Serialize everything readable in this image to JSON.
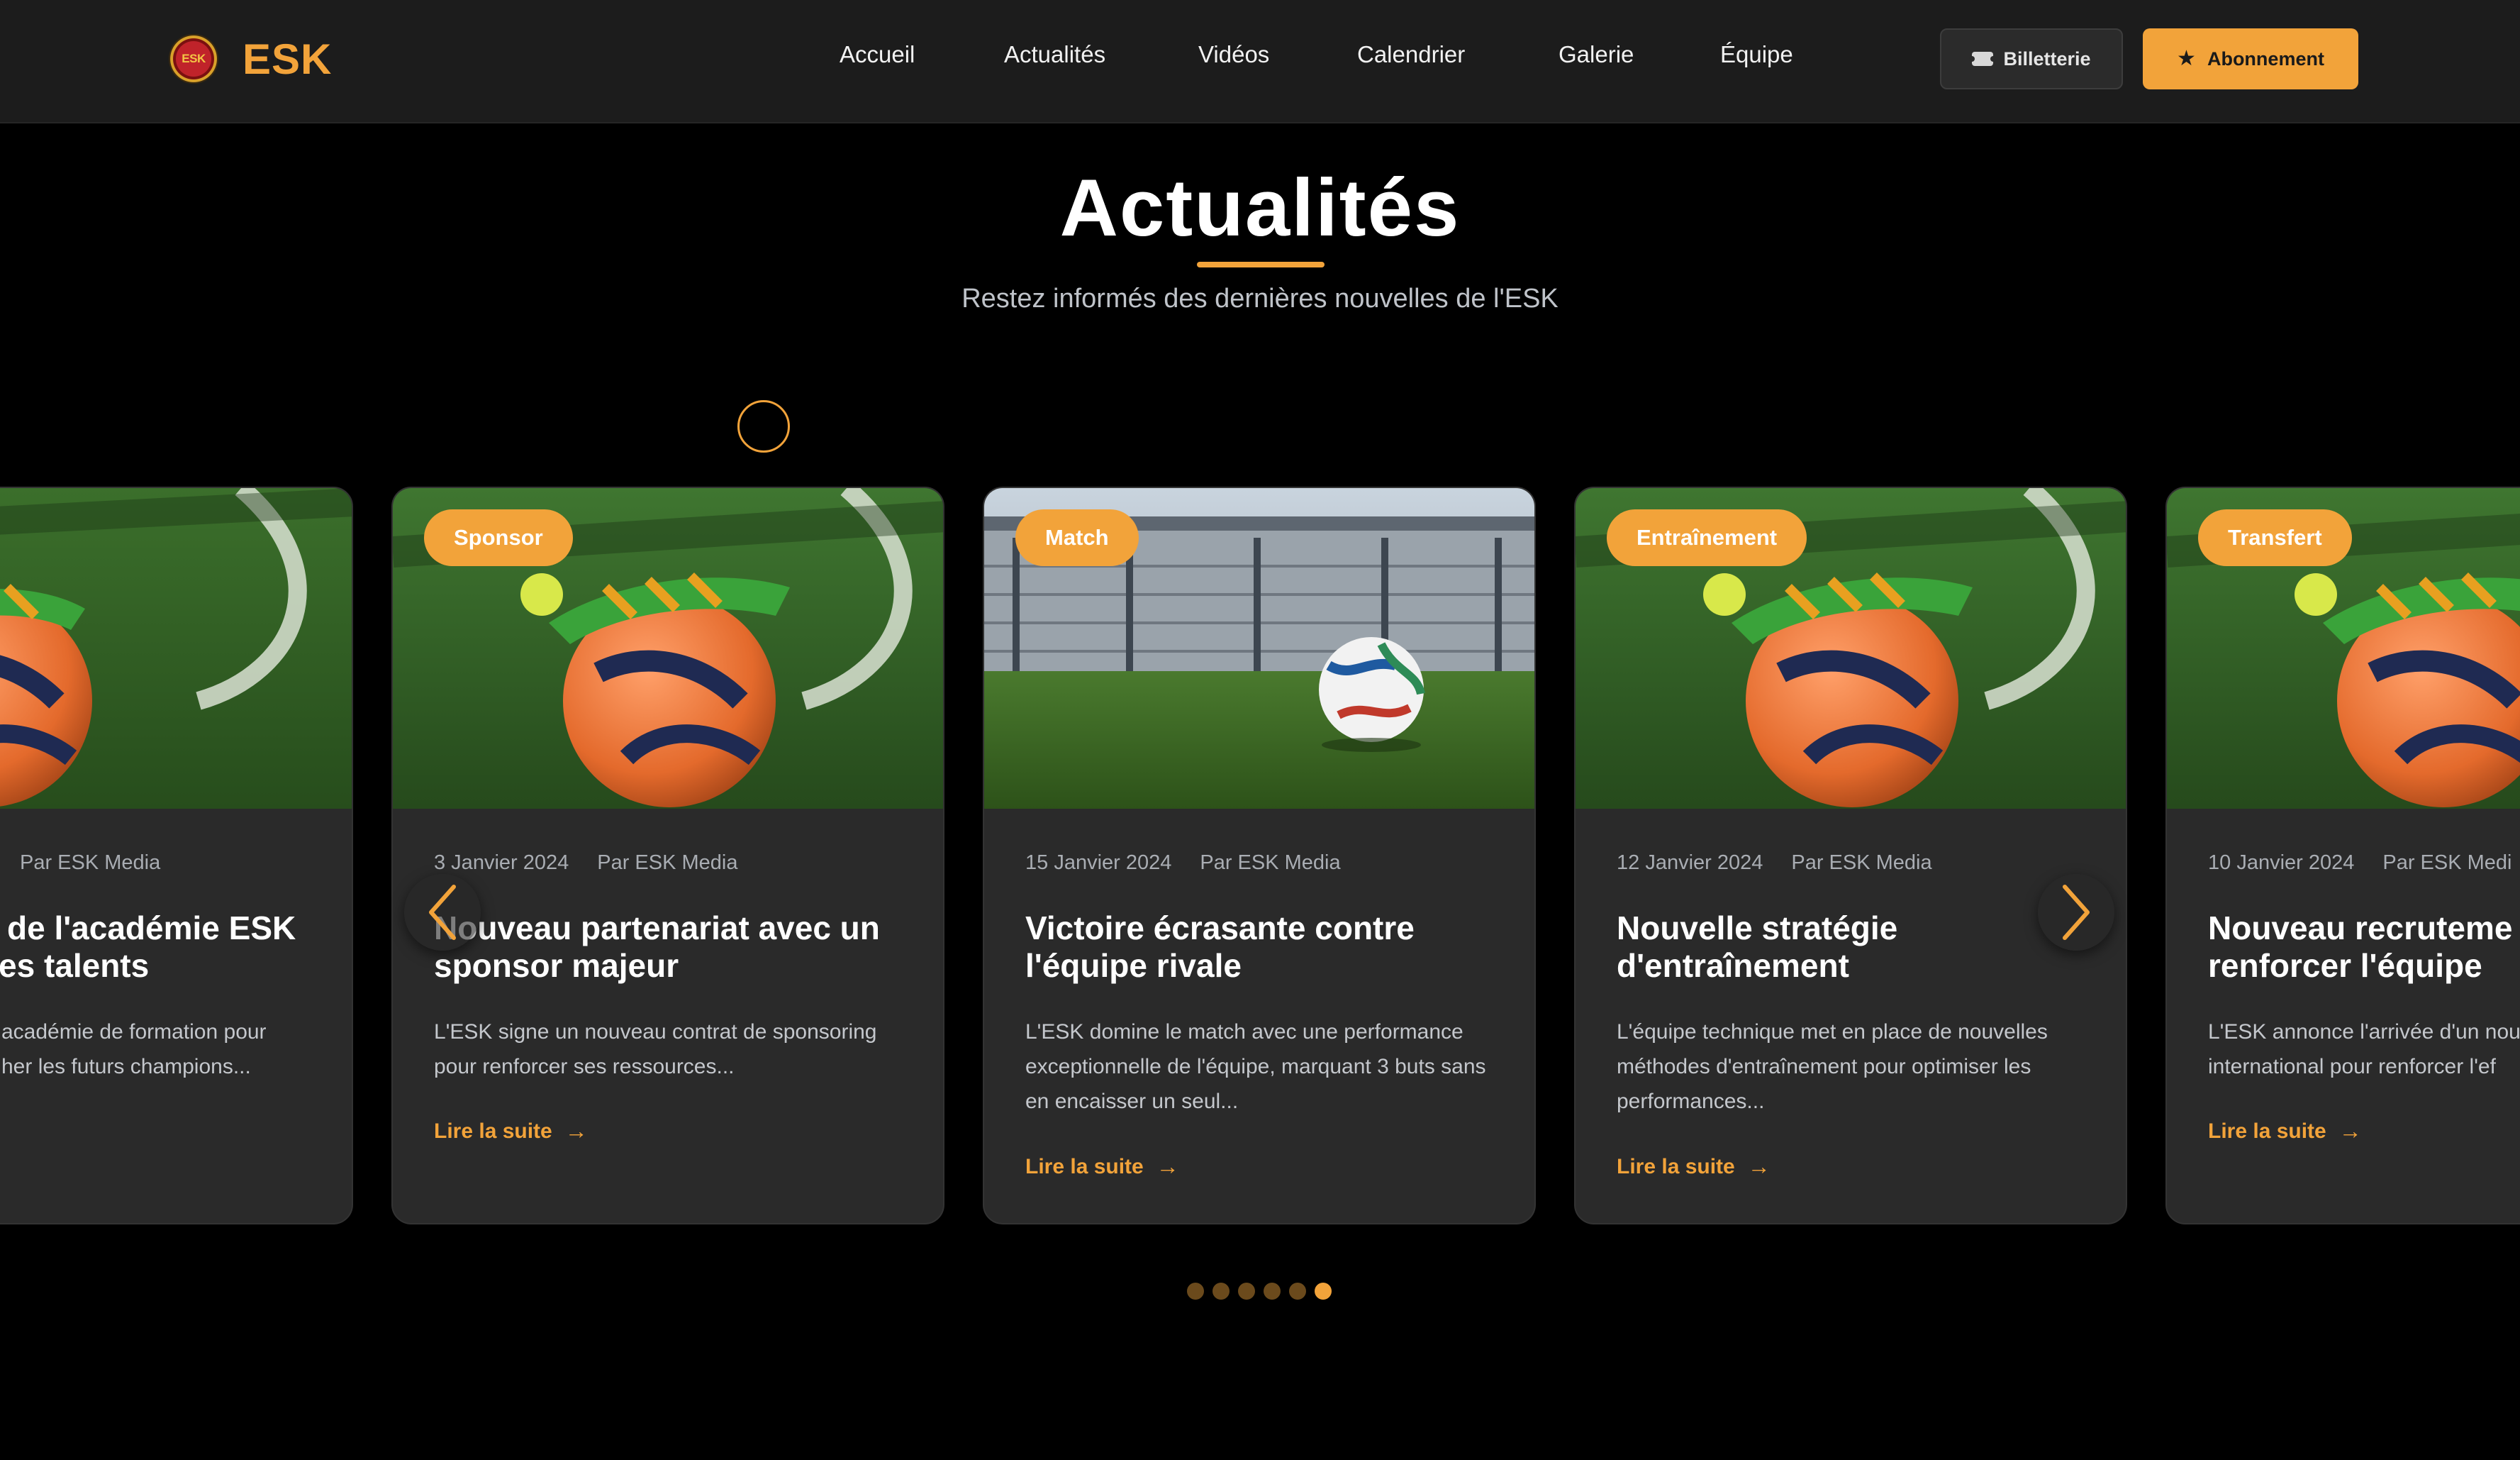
{
  "brand": {
    "logo_badge_text": "ESK",
    "name": "ESK",
    "accent_color": "#f2a33a"
  },
  "nav": {
    "items": [
      {
        "label": "Accueil"
      },
      {
        "label": "Actualités"
      },
      {
        "label": "Vidéos"
      },
      {
        "label": "Calendrier"
      },
      {
        "label": "Galerie"
      },
      {
        "label": "Équipe"
      }
    ]
  },
  "header_actions": {
    "ticket_label": "Billetterie",
    "ticket_icon": "ticket-icon",
    "subscribe_label": "Abonnement",
    "subscribe_icon": "star-icon"
  },
  "section": {
    "title": "Actualités",
    "subtitle": "Restez informés des dernières nouvelles de l'ESK"
  },
  "cards": [
    {
      "category": "",
      "date": "",
      "author": "Par ESK Media",
      "title": "… de l'académie ESK …es talents",
      "title_line1": "de l'académie ESK",
      "title_line2": "es talents",
      "excerpt_line1": "académie de formation pour",
      "excerpt_line2": "her les futurs champions...",
      "link": "",
      "image": "ball-on-grass"
    },
    {
      "category": "Sponsor",
      "date": "3 Janvier 2024",
      "author": "Par ESK Media",
      "title": "Nouveau partenariat avec un sponsor majeur",
      "excerpt": "L'ESK signe un nouveau contrat de sponsoring pour renforcer ses ressources...",
      "link": "Lire la suite",
      "image": "ball-on-grass"
    },
    {
      "category": "Match",
      "date": "15 Janvier 2024",
      "author": "Par ESK Media",
      "title": "Victoire écrasante contre l'équipe rivale",
      "excerpt": "L'ESK domine le match avec une performance exceptionnelle de l'équipe, marquant 3 buts sans en encaisser un seul...",
      "link": "Lire la suite",
      "image": "ball-in-stadium"
    },
    {
      "category": "Entraînement",
      "date": "12 Janvier 2024",
      "author": "Par ESK Media",
      "title": "Nouvelle stratégie d'entraînement",
      "excerpt": "L'équipe technique met en place de nouvelles méthodes d'entraînement pour optimiser les performances...",
      "link": "Lire la suite",
      "image": "ball-on-grass"
    },
    {
      "category": "Transfert",
      "date": "10 Janvier 2024",
      "author": "Par ESK Medi",
      "title_line1": "Nouveau recruteme",
      "title_line2": "renforcer l'équipe",
      "excerpt_line1": "L'ESK annonce l'arrivée d'un nou",
      "excerpt_line2": "international pour renforcer l'ef",
      "link": "Lire la suite",
      "image": "ball-on-grass"
    }
  ],
  "carousel": {
    "prev_icon": "chevron-left-icon",
    "next_icon": "chevron-right-icon",
    "dot_count": 6,
    "active_dot": 6
  }
}
